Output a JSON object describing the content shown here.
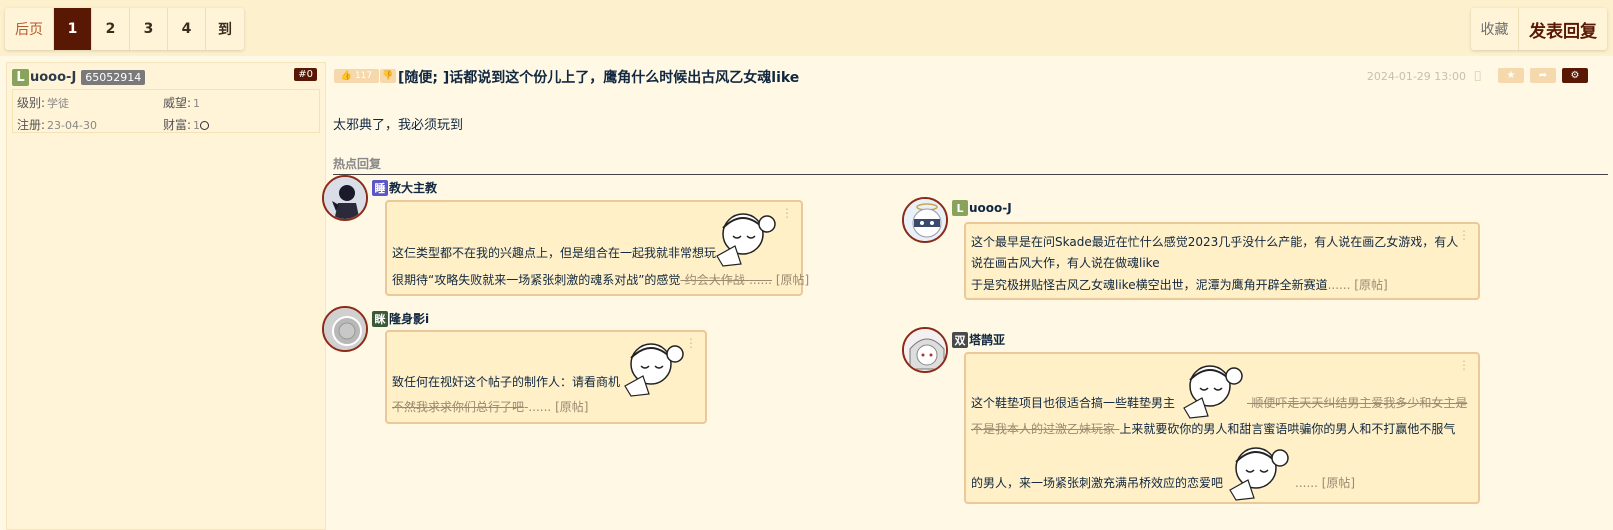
{
  "pager": {
    "prev_label": "后页",
    "pages": [
      "1",
      "2",
      "3",
      "4"
    ],
    "current": "1",
    "goto_label": "到"
  },
  "actions": {
    "favorite_label": "收藏",
    "reply_label": "发表回复"
  },
  "author": {
    "badge": "L",
    "name": "uooo-J",
    "uid": "65052914",
    "floor": "#0",
    "level_label": "级别:",
    "level_value": "学徒",
    "prestige_label": "威望:",
    "prestige_value": "1",
    "reg_label": "注册:",
    "reg_value": "23-04-30",
    "wealth_label": "财富:",
    "wealth_value": "1"
  },
  "post": {
    "likes": "117",
    "title": "[随便; ]话都说到这个份儿上了，鹰角什么时候出古风乙女魂like",
    "time": "2024-01-29 13:00",
    "content": "太邪典了，我必须玩到"
  },
  "hot_replies": {
    "title": "热点回复",
    "items": [
      {
        "icon": "睡",
        "icon_color": "#5a55c8",
        "name": "教大主教",
        "line1": "这仨类型都不在我的兴趣点上，但是组合在一起我就非常想玩",
        "line2": "很期待“攻略失败就来一场紧张刺激的魂系对战”的感觉",
        "line2_strike": "-约会大作战-",
        "suffix": "......",
        "orig": "[原帖]"
      },
      {
        "icon": "L",
        "icon_color": "#8aa35c",
        "name": "uooo-J",
        "line1": "这个最早是在问Skade最近在忙什么感觉2023几乎没什么产能，有人说在画乙女游戏，有人",
        "line2": "说在画古风大作，有人说在做魂like",
        "line3": "于是究极拼贴怪古风乙女魂like横空出世，泥潭为鹰角开辟全新赛道",
        "suffix": "......",
        "orig": "[原帖]"
      },
      {
        "icon": "眯",
        "icon_color": "#3a5a3a",
        "name": "隆身影i",
        "line1": "致任何在视奸这个帖子的制作人：请看商机",
        "line2_strike": "不然我求求你们总行了吧",
        "suffix": "-......",
        "orig": "[原帖]"
      },
      {
        "icon": "双",
        "icon_color": "#4a4a4a",
        "name": "塔鹊亚",
        "line1": "这个鞋垫项目也很适合搞一些鞋垫男主",
        "line1_strike": "-顺便吓走天天纠结男主爱我多少和女主是",
        "line2_strike": "不是我本人的过激乙妹玩家-",
        "line2": "上来就要砍你的男人和甜言蜜语哄骗你的男人和不打赢他不服气",
        "line3": "的男人，来一场紧张刺激充满吊桥效应的恋爱吧",
        "suffix": "......",
        "orig": "[原帖]"
      }
    ]
  },
  "colors": {
    "accent": "#591804",
    "background": "#fff8e5",
    "bubble": "#fff0c8",
    "bubble_border": "#ebc89a"
  }
}
